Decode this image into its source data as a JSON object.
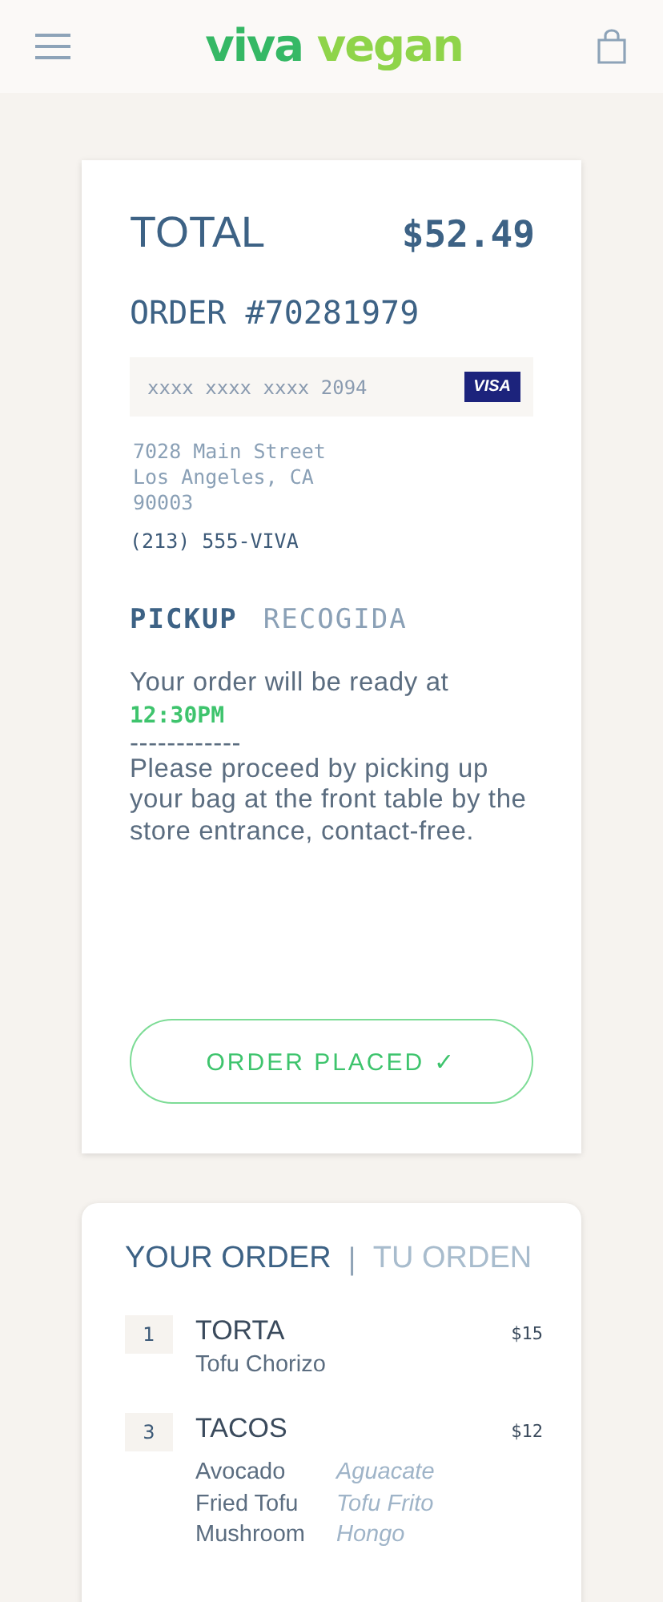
{
  "header": {
    "logo_dark": "viva",
    "logo_light": "vegan"
  },
  "summary": {
    "total_label": "TOTAL",
    "total": "$52.49",
    "order": "ORDER #70281979",
    "card_number": "xxxx xxxx xxxx 2094",
    "card_brand": "VISA",
    "address": [
      "7028 Main Street",
      "Los Angeles, CA",
      "90003"
    ],
    "phone": "(213) 555-VIVA",
    "tabs": [
      {
        "label": "PICKUP",
        "selected": true
      },
      {
        "label": "RECOGIDA",
        "selected": false
      }
    ],
    "ready_text": "Your order will be ready at",
    "ready_time": "12:30PM",
    "separator": "------------",
    "instructions": "Please proceed by picking up your bag at the front table by the store entrance, contact-free.",
    "button": "ORDER PLACED ✓"
  },
  "order": {
    "tabs": [
      {
        "label": "YOUR ORDER",
        "selected": true
      },
      {
        "label": "TU ORDEN",
        "selected": false
      }
    ],
    "divider": "|",
    "items": [
      {
        "qty": "1",
        "name": "TORTA",
        "price": "$15",
        "description": "Tofu Chorizo"
      },
      {
        "qty": "3",
        "name": "TACOS",
        "price": "$12",
        "options": [
          {
            "en": "Avocado",
            "es": "Aguacate"
          },
          {
            "en": "Fried Tofu",
            "es": "Tofu Frito"
          },
          {
            "en": "Mushroom",
            "es": "Hongo"
          }
        ]
      }
    ]
  }
}
